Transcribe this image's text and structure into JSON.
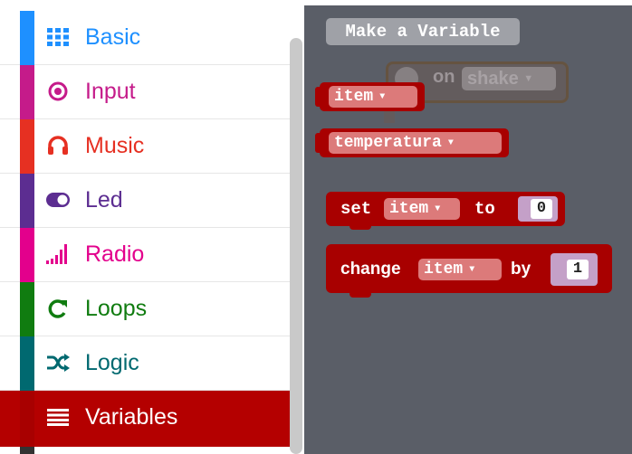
{
  "toolbox": {
    "categories": [
      {
        "label": "Basic",
        "icon": "grid-icon",
        "color": "#1e90ff"
      },
      {
        "label": "Input",
        "icon": "target-icon",
        "color": "#c51b8a"
      },
      {
        "label": "Music",
        "icon": "headphones-icon",
        "color": "#e63022"
      },
      {
        "label": "Led",
        "icon": "toggle-icon",
        "color": "#5c2d91"
      },
      {
        "label": "Radio",
        "icon": "signal-bars-icon",
        "color": "#e3008c"
      },
      {
        "label": "Loops",
        "icon": "loop-arrow-icon",
        "color": "#107c10"
      },
      {
        "label": "Logic",
        "icon": "shuffle-icon",
        "color": "#006970"
      },
      {
        "label": "Variables",
        "icon": "list-icon",
        "color": "#a80000",
        "selected": true
      }
    ]
  },
  "flyout": {
    "make_variable_label": "Make a Variable",
    "ghost_block": {
      "on": "on",
      "event": "shake"
    },
    "variable_blocks": [
      "item",
      "temperatura"
    ],
    "set_block": {
      "keyword": "set",
      "variable": "item",
      "to": "to",
      "value": "0"
    },
    "change_block": {
      "keyword": "change",
      "variable": "item",
      "by": "by",
      "value": "1"
    }
  },
  "colors": {
    "variables_block": "#a80000",
    "dropdown": "#dc7a7a",
    "workspace_bg": "#5a5e67",
    "selected_category_bg": "#b40000"
  }
}
